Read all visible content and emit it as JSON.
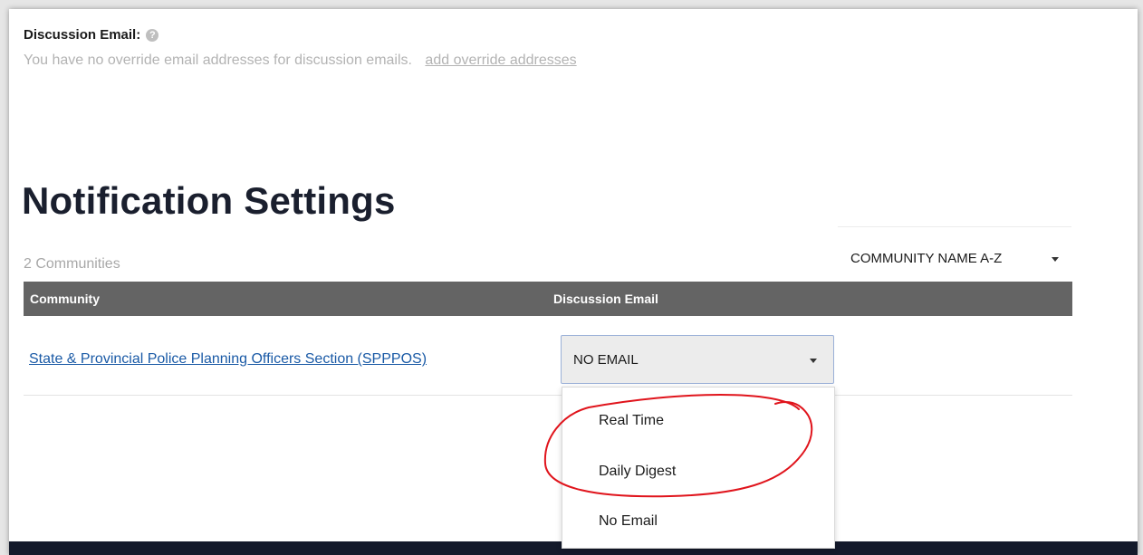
{
  "discussion_email": {
    "label": "Discussion Email:",
    "help_icon_glyph": "?",
    "override_text": "You have no override email addresses for discussion emails.",
    "add_override_link": "add override addresses"
  },
  "page_title": "Notification Settings",
  "sort": {
    "label": "COMMUNITY NAME A-Z",
    "icon": "caret-down-icon"
  },
  "community_count": "2 Communities",
  "table": {
    "columns": [
      "Community",
      "Discussion Email"
    ],
    "rows": [
      {
        "community": "State & Provincial Police Planning Officers Section (SPPPOS)",
        "discussion_email": "NO EMAIL"
      }
    ]
  },
  "dropdown": {
    "selected": "NO EMAIL",
    "options": [
      "Real Time",
      "Daily Digest",
      "No Email"
    ]
  },
  "annotation": {
    "color": "#e0141c"
  },
  "colors": {
    "header_bg": "#646464",
    "link": "#1a5aa6",
    "footer": "#141a2b",
    "title": "#1a1f2e"
  }
}
